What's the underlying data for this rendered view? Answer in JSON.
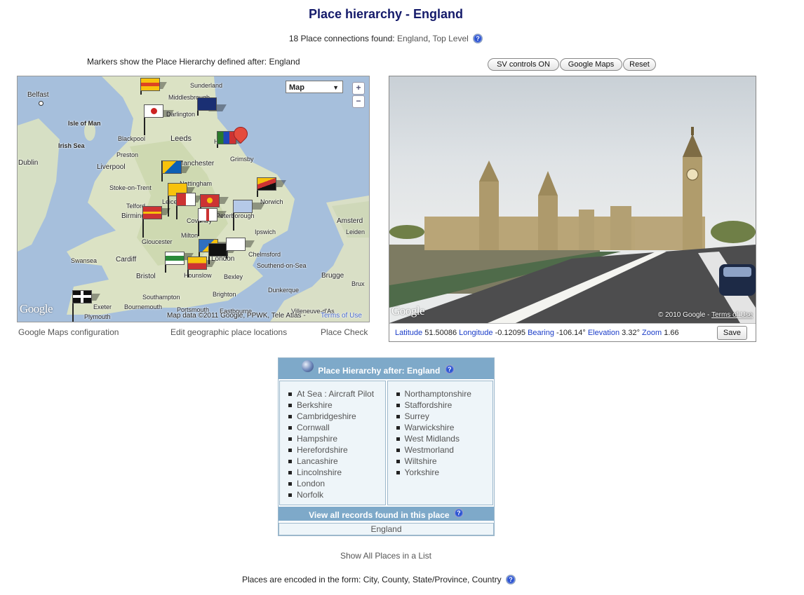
{
  "title": "Place hierarchy - England",
  "connections": {
    "text": "18 Place connections found:",
    "links": [
      "England",
      "Top Level"
    ]
  },
  "markers_caption": "Markers show the Place Hierarchy defined after: England",
  "sv_buttons": [
    "SV controls ON",
    "Google Maps",
    "Reset"
  ],
  "map": {
    "type_select": "Map",
    "zoom_in": "+",
    "zoom_out": "−",
    "attribution": "Map data ©2011 Google, PPWK, Tele Atlas -",
    "terms": "Terms of Use",
    "google": "Google",
    "places": [
      "Belfast",
      "Sunderland",
      "Middlesbrough",
      "Darlington",
      "Isle of Man",
      "Blackpool",
      "Leeds",
      "Irish Sea",
      "Preston",
      "Hull",
      "Grimsby",
      "Dublin",
      "Liverpool",
      "Manchester",
      "Stoke-on-Trent",
      "Nottingham",
      "Leicester",
      "Norwich",
      "Telford",
      "Birmingham",
      "Peterborough",
      "Coventry",
      "Milton",
      "Ipswich",
      "Gloucester",
      "Amsterd",
      "Leiden",
      "Swansea",
      "Cardiff",
      "Bristol",
      "London",
      "Chelmsford",
      "Southend-on-Sea",
      "Bexley",
      "Hounslow",
      "Brugge",
      "Brux",
      "Southampton",
      "Brighton",
      "Dunkerque",
      "Exeter",
      "Bournemouth",
      "Portsmouth",
      "Eastbourne",
      "Villeneuve-d'As",
      "Plymouth"
    ]
  },
  "map_links": [
    "Google Maps configuration",
    "Edit geographic place locations",
    "Place Check"
  ],
  "streetview": {
    "google": "Google",
    "copyright": "© 2010 Google -",
    "terms": "Terms of Use",
    "lat_label": "Latitude",
    "lat": "51.50086",
    "lon_label": "Longitude",
    "lon": "-0.12095",
    "bearing_label": "Bearing",
    "bearing": "-106.14°",
    "elev_label": "Elevation",
    "elev": "3.32°",
    "zoom_label": "Zoom",
    "zoom": "1.66",
    "save": "Save"
  },
  "hierarchy": {
    "header": "Place Hierarchy after: England",
    "left": [
      "At Sea : Aircraft Pilot",
      "Berkshire",
      "Cambridgeshire",
      "Cornwall",
      "Hampshire",
      "Herefordshire",
      "Lancashire",
      "Lincolnshire",
      "London",
      "Norfolk"
    ],
    "right": [
      "Northamptonshire",
      "Staffordshire",
      "Surrey",
      "Warwickshire",
      "West Midlands",
      "Westmorland",
      "Wiltshire",
      "Yorkshire"
    ],
    "view_all": "View all records found in this place",
    "current": "England"
  },
  "show_all": "Show All Places in a List",
  "footer": "Places are encoded in the form: City, County, State/Province, Country",
  "help_glyph": "?"
}
